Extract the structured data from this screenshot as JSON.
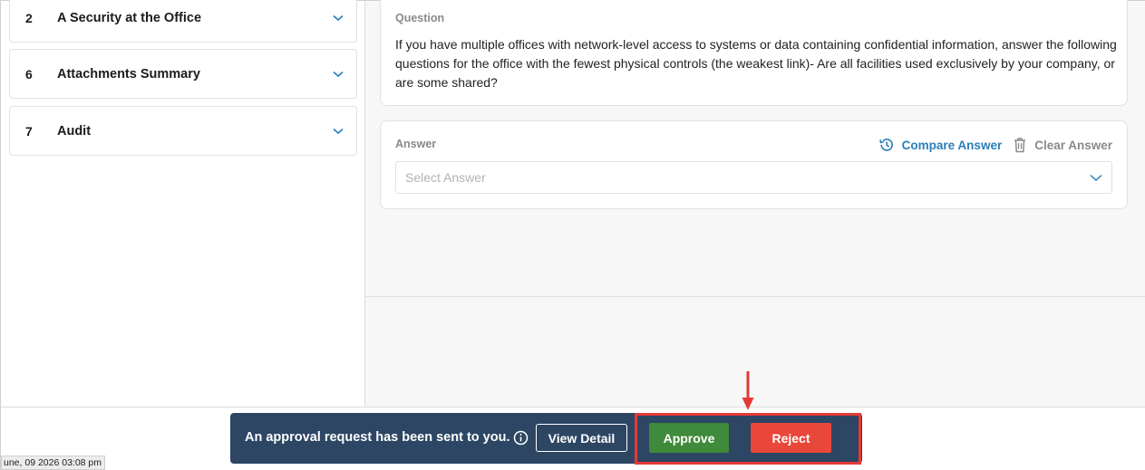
{
  "sidebar": {
    "sections": [
      {
        "number": "2",
        "title": "A Security at the Office",
        "icon": "chevron-down-icon"
      },
      {
        "number": "6",
        "title": "Attachments Summary",
        "icon": "chevron-down-icon"
      },
      {
        "number": "7",
        "title": "Audit",
        "icon": "chevron-down-icon"
      }
    ]
  },
  "question": {
    "label": "Question",
    "text": "If you have multiple offices with network-level access to systems or data containing confidential information, answer the following questions for the office with the fewest physical controls (the weakest link)- Are all facilities used exclusively by your company, or are some shared?"
  },
  "answer": {
    "label": "Answer",
    "compare_label": "Compare Answer",
    "clear_label": "Clear Answer",
    "select_placeholder": "Select Answer"
  },
  "toast": {
    "message": "An approval request has been sent to you.",
    "view_detail_label": "View Detail",
    "approve_label": "Approve",
    "reject_label": "Reject"
  },
  "timestamp": "une, 09 2026 03:08 pm",
  "colors": {
    "accent_blue": "#2a7fb8",
    "toast_bg": "#2c4664",
    "approve_green": "#3f8a3b",
    "reject_red": "#e8473a",
    "annotation_red": "#e53935"
  }
}
